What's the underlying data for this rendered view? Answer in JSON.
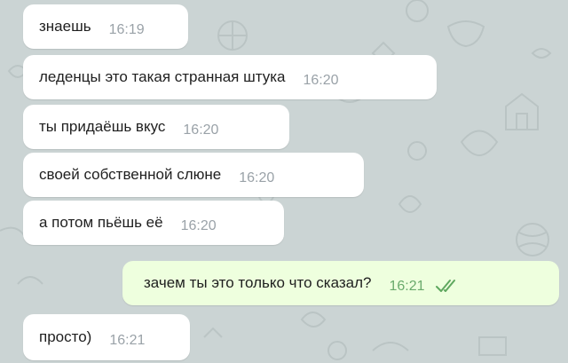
{
  "colors": {
    "background": "#cbd4d4",
    "incoming": "#ffffff",
    "outgoing": "#eeffde",
    "read_check": "#5fa85f"
  },
  "messages": [
    {
      "text": "знаешь",
      "time": "16:19",
      "dir": "in"
    },
    {
      "text": "леденцы это такая странная штука",
      "time": "16:20",
      "dir": "in"
    },
    {
      "text": "ты придаёшь вкус",
      "time": "16:20",
      "dir": "in"
    },
    {
      "text": "своей собственной слюне",
      "time": "16:20",
      "dir": "in"
    },
    {
      "text": "а потом пьёшь её",
      "time": "16:20",
      "dir": "in"
    },
    {
      "text": "зачем ты это только что сказал?",
      "time": "16:21",
      "dir": "out",
      "status_icon": "double-check-icon"
    },
    {
      "text": "просто)",
      "time": "16:21",
      "dir": "in"
    }
  ]
}
